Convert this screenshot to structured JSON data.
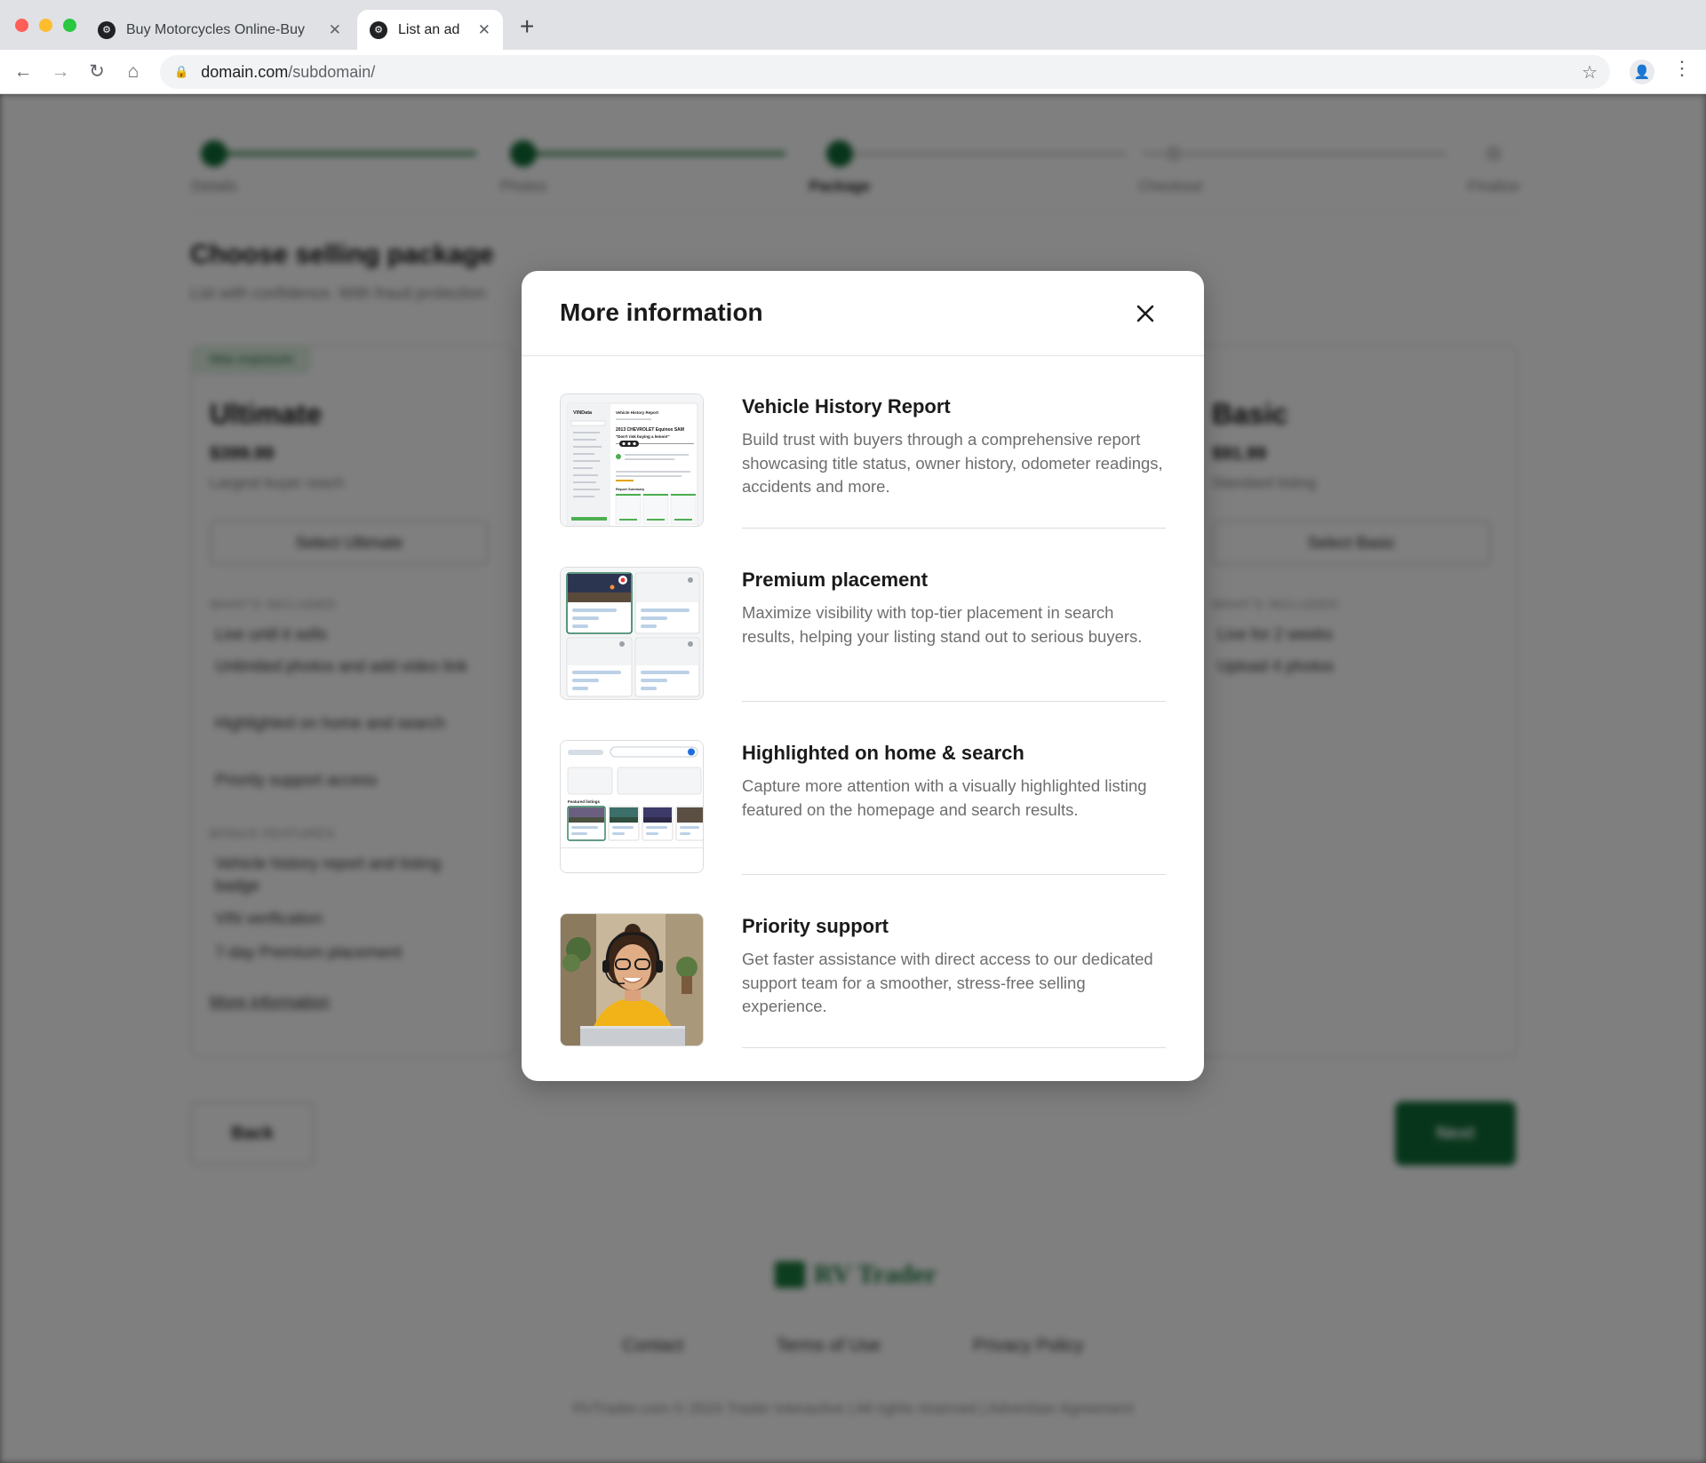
{
  "browser": {
    "tabs": [
      {
        "title": "Buy Motorcycles Online-Buy",
        "active": false
      },
      {
        "title": "List an ad",
        "active": true
      }
    ],
    "url_host": "domain.com",
    "url_path": "/subdomain/"
  },
  "page": {
    "steps": [
      "Details",
      "Photos",
      "Package",
      "Checkout",
      "Finalize"
    ],
    "title": "Choose selling package",
    "subtitle": "List with confidence. With fraud protection",
    "packages": [
      {
        "badge": "Max exposure",
        "name": "Ultimate",
        "price": "$399.99",
        "desc": "Largest buyer reach",
        "select_label": "Select Ultimate",
        "included_heading": "WHAT'S INCLUDED",
        "included": [
          "Live until it sells",
          "Unlimited photos and add video link",
          "Highlighted on home and search",
          "Priority support access"
        ],
        "bonus_heading": "BONUS FEATURES",
        "bonus": [
          "Vehicle history report and listing badge",
          "VIN verification",
          "7-day Premium placement"
        ],
        "more_label": "More information"
      },
      {
        "badge": "",
        "name": "Basic",
        "price": "$91.99",
        "desc": "Standard listing",
        "select_label": "Select Basic",
        "included_heading": "WHAT'S INCLUDED",
        "included": [
          "Live for 2 weeks",
          "Upload 4 photos"
        ]
      }
    ],
    "back_label": "Back",
    "next_label": "Next",
    "footer": {
      "logo": "RV Trader",
      "links": [
        "Contact",
        "Terms of Use",
        "Privacy Policy"
      ],
      "copyright": "RVTrader.com © 2024 Trader Interactive | All rights reserved | Advertiser Agreement"
    }
  },
  "modal": {
    "title": "More information",
    "items": [
      {
        "title": "Vehicle History Report",
        "desc": "Build trust with buyers through a comprehensive report showcasing title status, owner history, odometer readings, accidents and more.",
        "thumb": "vehicle-report-thumbnail"
      },
      {
        "title": "Premium placement",
        "desc": "Maximize visibility with top-tier placement in search results, helping your listing stand out to serious buyers.",
        "thumb": "premium-placement-thumbnail"
      },
      {
        "title": "Highlighted on home & search",
        "desc": "Capture more attention with a visually highlighted listing featured on the homepage and search results.",
        "thumb": "featured-listings-thumbnail"
      },
      {
        "title": "Priority support",
        "desc": "Get faster assistance with direct access to our dedicated support team for a smoother, stress-free selling experience.",
        "thumb": "support-agent-photo"
      }
    ],
    "thumb_text": {
      "report_brand": "VINData",
      "report_heading": "Vehicle History Report",
      "report_vehicle": "2013 CHEVROLET Equinox SAM",
      "report_tagline": "\"Don't risk buying a lemon!\"",
      "report_summary": "Report Summary",
      "featured_label": "Featured listings"
    }
  },
  "colors": {
    "brand_green": "#0f6b36",
    "overlay": "#808080",
    "modal_bg": "#ffffff",
    "text_primary": "#1a1a1a",
    "text_secondary": "#6e6e6e"
  }
}
